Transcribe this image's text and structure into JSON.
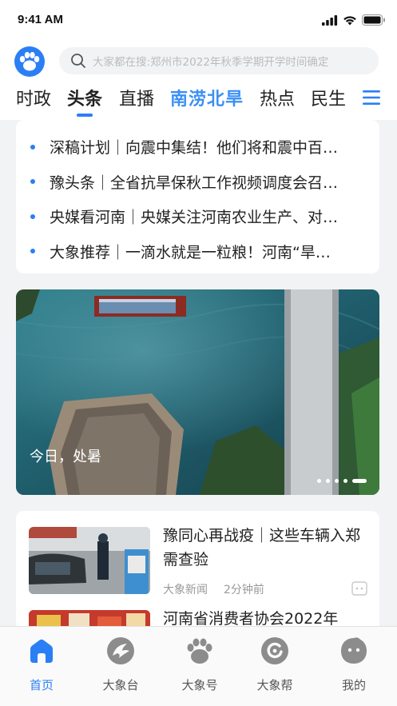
{
  "status": {
    "time": "9:41 AM"
  },
  "search": {
    "placeholder": "大家都在搜:郑州市2022年秋季学期开学时间确定"
  },
  "tabs": [
    {
      "label": "时政"
    },
    {
      "label": "头条"
    },
    {
      "label": "直播"
    },
    {
      "label": "南涝北旱"
    },
    {
      "label": "热点"
    },
    {
      "label": "民生"
    }
  ],
  "active_tab": "头条",
  "headlines": [
    {
      "text": "深稿计划｜向震中集结！他们将和震中百…"
    },
    {
      "text": "豫头条｜全省抗旱保秋工作视频调度会召…"
    },
    {
      "text": "央媒看河南｜央媒关注河南农业生产、对…"
    },
    {
      "text": "大象推荐｜一滴水就是一粒粮！河南“旱…"
    }
  ],
  "banner": {
    "caption": "今日，处暑",
    "slide_count": 5,
    "active_slide": 5
  },
  "news": [
    {
      "title": "豫同心再战疫｜这些车辆入郑需查验",
      "source": "大象新闻",
      "time": "2分钟前"
    },
    {
      "title": "河南省消费者协会2022年"
    }
  ],
  "tabbar": [
    {
      "label": "首页",
      "icon": "home-icon"
    },
    {
      "label": "大象台",
      "icon": "tv-logo-icon"
    },
    {
      "label": "大象号",
      "icon": "paw-icon"
    },
    {
      "label": "大象帮",
      "icon": "help-icon"
    },
    {
      "label": "我的",
      "icon": "profile-icon"
    }
  ],
  "colors": {
    "accent": "#2a7ff5",
    "special_tab": "#3a8ff5",
    "inactive_icon": "#8c8c8c"
  }
}
